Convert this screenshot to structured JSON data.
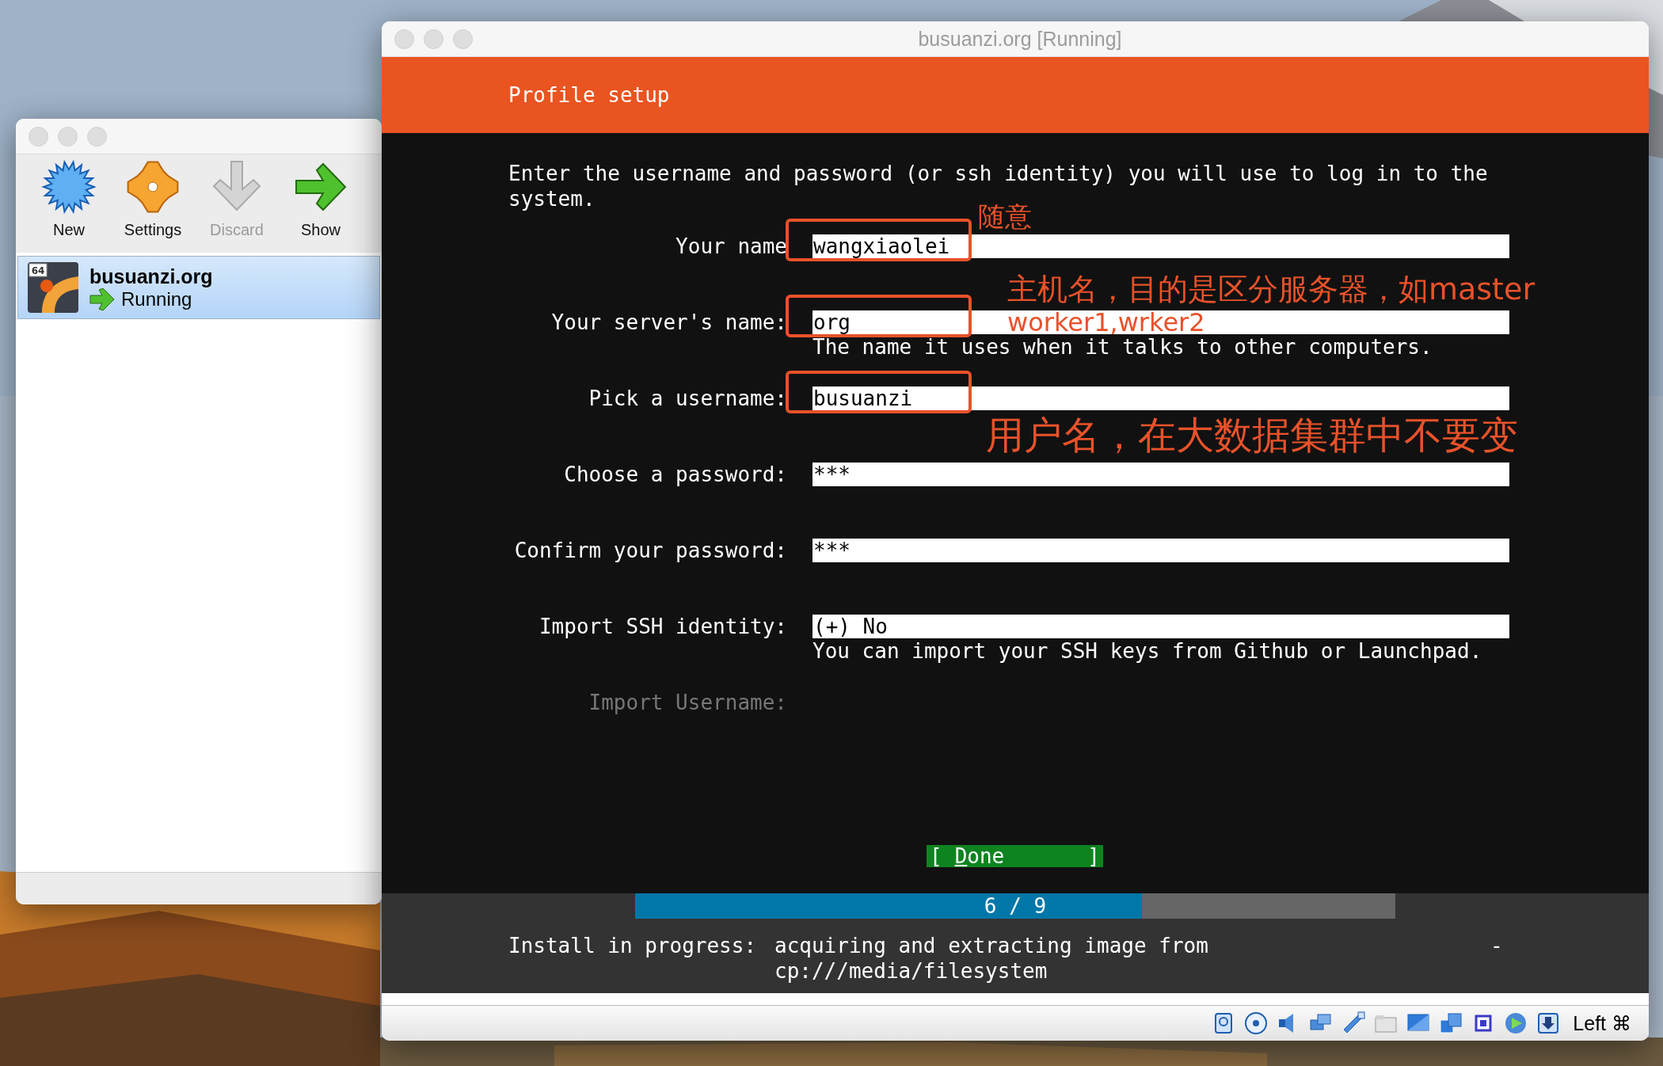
{
  "manager_window": {
    "toolbar": [
      {
        "label": "New",
        "disabled": false
      },
      {
        "label": "Settings",
        "disabled": false
      },
      {
        "label": "Discard",
        "disabled": true
      },
      {
        "label": "Show",
        "disabled": false
      }
    ],
    "machines": [
      {
        "badge": "64",
        "name": "busuanzi.org",
        "status": "Running",
        "selected": true
      }
    ]
  },
  "vm_window": {
    "title": "busuanzi.org [Running]",
    "header": "Profile setup",
    "intro": "Enter the username and password (or ssh identity) you will use to log in to the system.",
    "fields": [
      {
        "label": "Your name",
        "value": "wangxiaolei",
        "disabled": false,
        "highlighted": true
      },
      {
        "label": "Your server's name:",
        "value": "org",
        "help": "The name it uses when it talks to other computers.",
        "disabled": false,
        "highlighted": true
      },
      {
        "label": "Pick a username:",
        "value": "busuanzi",
        "disabled": false,
        "highlighted": true
      },
      {
        "label": "Choose a password:",
        "value": "***",
        "disabled": false,
        "highlighted": false
      },
      {
        "label": "Confirm your password:",
        "value": "***",
        "disabled": false,
        "highlighted": false
      },
      {
        "label": "Import SSH identity:",
        "value": "(+) No",
        "help": "You can import your SSH keys from Github or Launchpad.",
        "disabled": false,
        "highlighted": false
      },
      {
        "label": "Import Username:",
        "disabled": true,
        "highlighted": false
      }
    ],
    "done_button": {
      "open": "[",
      "label": "Done",
      "close": "]"
    },
    "progress": {
      "label": "6 / 9",
      "level": 0.667
    },
    "install_status": {
      "prefix": "Install in progress:",
      "message_lines": [
        "acquiring and extracting image from",
        "cp:///media/filesystem"
      ],
      "spinner": "-"
    },
    "annotations": [
      {
        "text": "随意"
      },
      {
        "text": "主机名，目的是区分服务器，如master"
      },
      {
        "text": "worker1,wrker2"
      },
      {
        "text": "用户名，在大数据集群中不要变"
      }
    ],
    "status_bar": {
      "host_key": "Left ⌘"
    }
  }
}
